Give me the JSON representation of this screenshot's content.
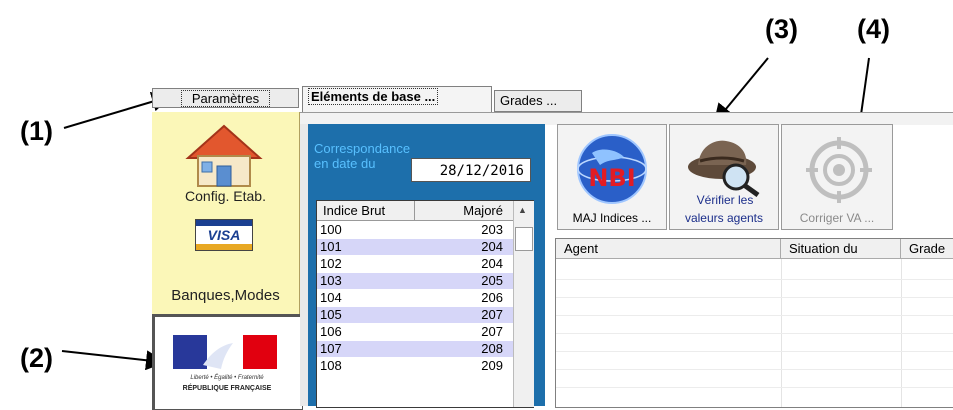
{
  "callouts": [
    "(1)",
    "(2)",
    "(3)",
    "(4)"
  ],
  "tabs": {
    "params": "Paramètres",
    "base": "Eléments de base ...",
    "grades": "Grades ..."
  },
  "sidebar": {
    "config_label": "Config. Etab.",
    "visa_label": "VISA",
    "banques_label": "Banques,Modes",
    "rf_motto": "Liberté • Égalité • Fraternité",
    "rf_name": "RÉPUBLIQUE FRANÇAISE"
  },
  "correspondance": {
    "label_line1": "Correspondance",
    "label_line2": "en date du",
    "date": "28/12/2016"
  },
  "indices_table": {
    "headers": [
      "Indice Brut",
      "Majoré"
    ],
    "rows": [
      [
        "100",
        "203"
      ],
      [
        "101",
        "204"
      ],
      [
        "102",
        "204"
      ],
      [
        "103",
        "205"
      ],
      [
        "104",
        "206"
      ],
      [
        "105",
        "207"
      ],
      [
        "106",
        "207"
      ],
      [
        "107",
        "208"
      ],
      [
        "108",
        "209"
      ]
    ]
  },
  "toolbar": {
    "maj_label": "MAJ Indices ...",
    "verifier_line1": "Vérifier les",
    "verifier_line2": "valeurs agents",
    "corriger_label": "Corriger VA ..."
  },
  "agents_table": {
    "headers": [
      "Agent",
      "Situation du",
      "Grade"
    ]
  },
  "colors": {
    "accent_blue": "#1d6fab",
    "side_yellow": "#fbf7b8",
    "row_blue": "#d6d6f8"
  }
}
